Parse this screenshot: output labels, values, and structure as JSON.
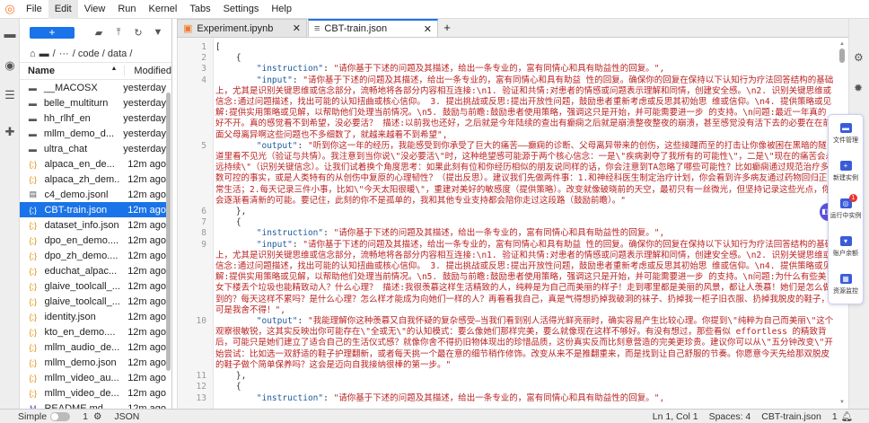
{
  "menubar": {
    "items": [
      "File",
      "Edit",
      "View",
      "Run",
      "Kernel",
      "Tabs",
      "Settings",
      "Help"
    ],
    "active": "Edit"
  },
  "filebrowser": {
    "new_label": "+",
    "breadcrumb": [
      "/",
      "···",
      "/ code / data /"
    ],
    "columns": {
      "name": "Name",
      "modified": "Modified"
    },
    "files": [
      {
        "name": "__MACOSX",
        "modified": "yesterday",
        "type": "folder"
      },
      {
        "name": "belle_multiturn",
        "modified": "yesterday",
        "type": "folder"
      },
      {
        "name": "hh_rlhf_en",
        "modified": "yesterday",
        "type": "folder"
      },
      {
        "name": "mllm_demo_d...",
        "modified": "yesterday",
        "type": "folder"
      },
      {
        "name": "ultra_chat",
        "modified": "yesterday",
        "type": "folder"
      },
      {
        "name": "alpaca_en_de...",
        "modified": "12m ago",
        "type": "json"
      },
      {
        "name": "alpaca_zh_dem...",
        "modified": "12m ago",
        "type": "json"
      },
      {
        "name": "c4_demo.jsonl",
        "modified": "12m ago",
        "type": "file"
      },
      {
        "name": "CBT-train.json",
        "modified": "12m ago",
        "type": "json",
        "selected": true
      },
      {
        "name": "dataset_info.json",
        "modified": "12m ago",
        "type": "json"
      },
      {
        "name": "dpo_en_demo....",
        "modified": "12m ago",
        "type": "json"
      },
      {
        "name": "dpo_zh_demo....",
        "modified": "12m ago",
        "type": "json"
      },
      {
        "name": "educhat_alpac...",
        "modified": "12m ago",
        "type": "json"
      },
      {
        "name": "glaive_toolcall_...",
        "modified": "12m ago",
        "type": "json"
      },
      {
        "name": "glaive_toolcall_...",
        "modified": "12m ago",
        "type": "json"
      },
      {
        "name": "identity.json",
        "modified": "12m ago",
        "type": "json"
      },
      {
        "name": "kto_en_demo....",
        "modified": "12m ago",
        "type": "json"
      },
      {
        "name": "mllm_audio_de...",
        "modified": "12m ago",
        "type": "json"
      },
      {
        "name": "mllm_demo.json",
        "modified": "12m ago",
        "type": "json"
      },
      {
        "name": "mllm_video_au...",
        "modified": "12m ago",
        "type": "json"
      },
      {
        "name": "mllm_video_de...",
        "modified": "12m ago",
        "type": "json"
      },
      {
        "name": "README.md",
        "modified": "12m ago",
        "type": "md"
      }
    ]
  },
  "tabs": [
    {
      "label": "Experiment.ipynb",
      "icon": "notebook-icon",
      "active": false
    },
    {
      "label": "CBT-train.json",
      "icon": "file-icon",
      "active": true
    }
  ],
  "editor": {
    "lines": [
      {
        "n": "1",
        "text": "["
      },
      {
        "n": "2",
        "text": "    {"
      },
      {
        "n": "3",
        "key": "instruction",
        "value": "请你基于下述的问题及其描述，给出一条专业的，富有同情心和具有助益性的回复。",
        "end": ","
      },
      {
        "n": "4",
        "key": "input",
        "value": "请你基于下述的问题及其描述，给出一条专业的，富有同情心和具有助益 性的回复。确保你的回复在保持以下认知行为疗法回答结构的基础上，尤其是识别关键思维或信念部分，流畅地将各部分内容相互连接:\\n1. 验证和共情:对患者的情感或问题表示理解和同情，创建安全感。\\n2. 识别关键思维或信念:通过问题描述，找出可能的认知扭曲或核心信仰。 3. 提出挑战或反思:提出开放性问题，鼓励患者重新考虑或反思其初始思 维或信仰。\\n4. 提供策略或见解:提供实用策略或见解，以帮助他们处理当前情况。\\n5. 鼓励与前瞻:鼓励患者使用策略，强调这只是开始，并可能需要进一步 的支持。\\n问题:最近一年真的好不开。真的感觉看不到希望，没必要活？ 描述:以前我也还好，之后就是今年陆续的查出有癫痫之后就是崩溃整夜整夜的崩溃，甚至感觉没有活下去的必要在在前面父母离异啊这些问题也不多细数了，就越来越看不到希望",
        "end": ","
      },
      {
        "n": "5",
        "key": "output",
        "value": "听到你这一年的经历，我能感受到你承受了巨大的痛苦——癫痫的诊断、父母离异带来的创伤，这些接踵而至的打击让你像被困在黑暗的隧道里看不见光（验证与共情）。我注意到当你说\\\"没必要活\\\"时，这种绝望感可能源于两个核心信念：一是\\\"疾病剥夺了我所有的可能性\\\"，二是\\\"现在的痛苦会永远持续\\\"（识别关键信念）。让我们试着换个角度思考：如果此刻有位和你经历相似的朋友说同样的话，你会注意到TA忽略了哪些可能性？比如癫痫通过规范治疗多数可控的事实，或是人类特有的从创伤中复原的心理韧性？（提出反思）。建议我们先做两件事：1.和神经科医生制定治疗计划，你会看到许多病友通过药物回归正常生活；2.每天记录三件小事，比如\\\"今天太阳很暖\\\"，重建对美好的敏感度（提供策略）。改变就像破晓前的天空，最初只有一丝微光，但坚持记录这些光点，你会逐渐看清新的可能。要记住，此刻的你不是孤单的，我和其他专业支持都会陪你走过这段路（鼓励前瞻）。",
        "end": ""
      },
      {
        "n": "6",
        "text": "    },"
      },
      {
        "n": "7",
        "text": "    {"
      },
      {
        "n": "8",
        "key": "instruction",
        "value": "请你基于下述的问题及其描述，给出一条专业的，富有同情心和具有助益性的回复。",
        "end": ","
      },
      {
        "n": "9",
        "key": "input",
        "value": "请你基于下述的问题及其描述，给出一条专业的，富有同情心和具有助益 性的回复。确保你的回复在保持以下认知行为疗法回答结构的基础上，尤其是识别关键思维或信念部分，流畅地将各部分内容相互连接:\\n1. 验证和共情:对患者的情感或问题表示理解和同情，创建安全感。\\n2. 识别关键思维或信念:通过问题描述，找出可能的认知扭曲或核心信仰。 3. 提出挑战或反思:提出开放性问题，鼓励患者重新考虑或反思其初始思 维或信仰。\\n4. 提供策略或见解:提供实用策略或见解，以帮助他们处理当前情况。\\n5. 鼓励与前瞻:鼓励患者使用策略，强调这只是开始，并可能需要进一步 的支持。\\n问题:为什么有些美女下楼丢个垃圾也能精致动人？什么心理？ 描述:我很羡慕这样生活精致的人，纯粹是为自己而美丽的样子！走到哪里都是美丽的风景，都让人羡慕！她们是怎么做到的？每天这样不累吗？是什么心理？怎么样才能成为向她们一样的人？再看看我自己，真是气得想扔掉我破洞的袜子、扔掉我一柜子旧衣服、扔掉我脱皮的鞋子，可是我舍不得！",
        "end": ","
      },
      {
        "n": "10",
        "key": "output",
        "value": "我能理解你这种羡慕又自我怀疑的复杂感受—当我们看到别人活得光鲜亮丽时，确实容易产生比较心理。你提到\\\"纯粹为自己而美丽\\\"这个观察很敏锐，这其实反映出你可能存在\\\"全或无\\\"的认知模式：要么像她们那样完美，要么就像现在这样不够好。有没有想过，那些看似 effortless 的精致背后，可能只是她们建立了适合自己的生活仪式感？就像你舍不得扔旧物体现出的珍惜品质，这份真实反而比刻意营造的完美更珍贵。建议你可以从\\\"五分钟改变\\\"开始尝试：比如选一双舒适的鞋子护理翻新，或者每天挑一个最在意的细节稍作修饰。改变从来不是推翻重来，而是找到让自己舒服的节奏。你愿意今天先给那双脱皮的鞋子做个简单保养吗？这会是迈向自我接纳很棒的第一步。",
        "end": ""
      },
      {
        "n": "11",
        "text": "    },"
      },
      {
        "n": "12",
        "text": "    {"
      },
      {
        "n": "13",
        "key": "instruction",
        "value": "请你基于下述的问题及其描述，给出一条专业的，富有同情心和具有助益性的回复。",
        "end": ","
      }
    ]
  },
  "floatpanel": {
    "items": [
      {
        "label": "文件管理",
        "icon": "folder-icon"
      },
      {
        "label": "新建实例",
        "icon": "add-instance-icon"
      },
      {
        "label": "运行中实例",
        "icon": "running-instance-icon",
        "badge": "1"
      },
      {
        "label": "账户余额",
        "icon": "wallet-icon"
      },
      {
        "label": "资源监控",
        "icon": "chip-icon"
      }
    ]
  },
  "statusbar": {
    "mode": "Simple",
    "kernels": "1",
    "filetype": "JSON",
    "position": "Ln 1, Col 1",
    "spaces": "Spaces: 4",
    "filename": "CBT-train.json",
    "notifications": "1"
  },
  "colors": {
    "accent": "#1a73e8",
    "json_key": "#1e5a9c",
    "json_string": "#b22222",
    "panel_icon": "#3a5bd9"
  }
}
